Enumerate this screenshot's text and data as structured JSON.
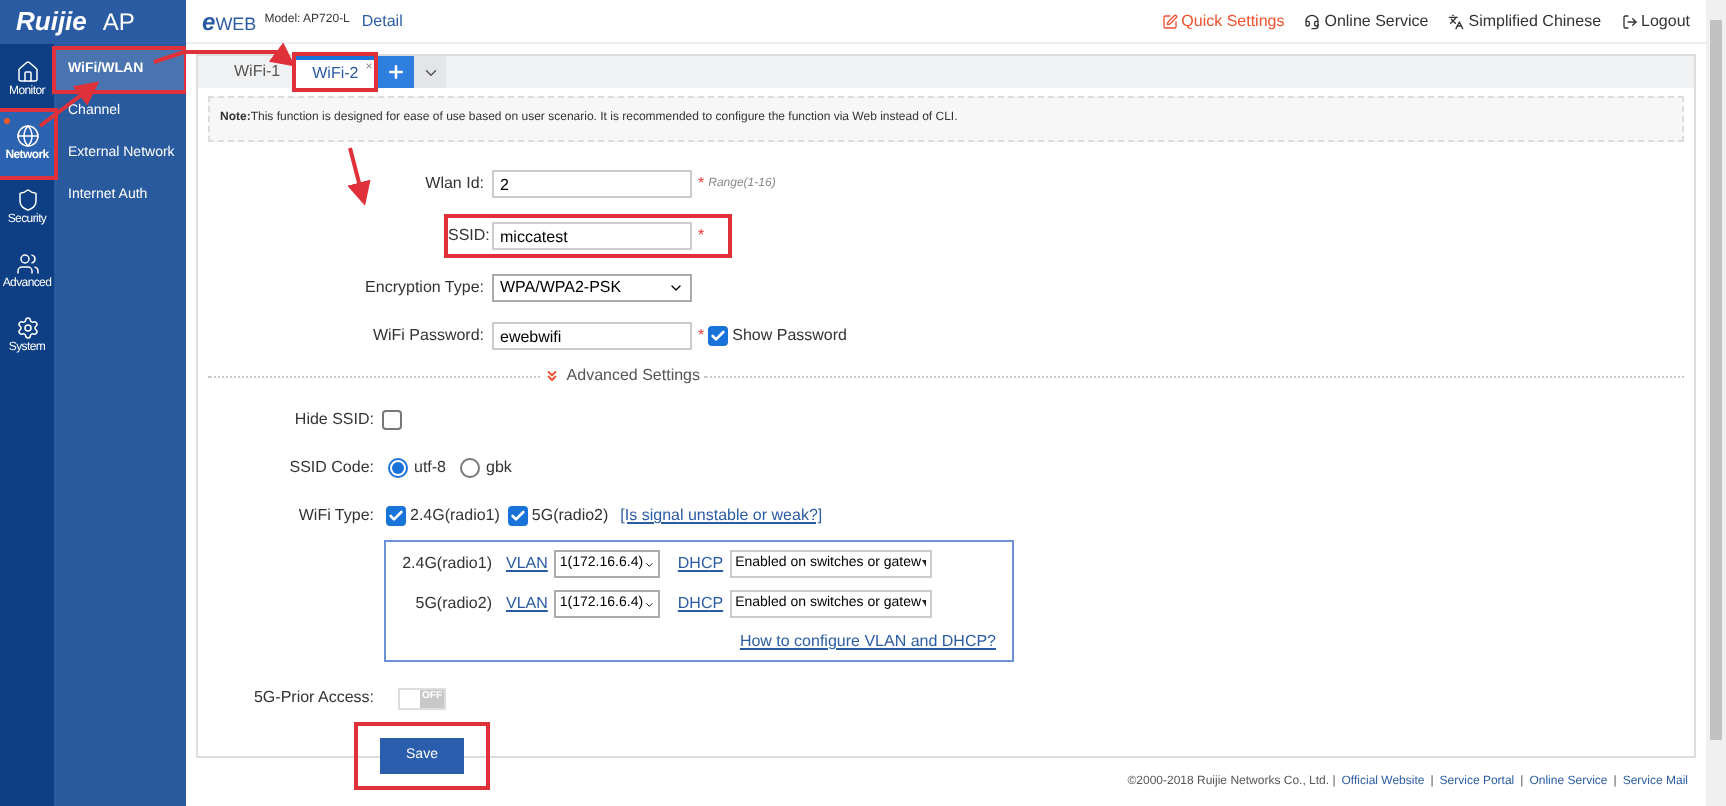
{
  "brand": {
    "logo": "Ruijie",
    "product": "AP"
  },
  "header": {
    "eweb_mark": "e",
    "eweb": "WEB",
    "model": "Model: AP720-L",
    "detail_link": "Detail",
    "actions": [
      {
        "kind": "quick",
        "label": "Quick Settings"
      },
      {
        "kind": "service",
        "label": "Online Service"
      },
      {
        "kind": "language",
        "label": "Simplified Chinese"
      },
      {
        "kind": "logout",
        "label": "Logout"
      }
    ]
  },
  "nav_rail": [
    {
      "kind": "monitor",
      "label": "Monitor",
      "selected": false,
      "annotated": false
    },
    {
      "kind": "network",
      "label": "Network",
      "selected": true,
      "annotated": true
    },
    {
      "kind": "security",
      "label": "Security",
      "selected": false,
      "annotated": false
    },
    {
      "kind": "advanced",
      "label": "Advanced",
      "selected": false,
      "annotated": false
    },
    {
      "kind": "system",
      "label": "System",
      "selected": false,
      "annotated": false
    }
  ],
  "submenu": [
    {
      "label": "WiFi/WLAN",
      "selected": true,
      "annotated": true
    },
    {
      "label": "Channel",
      "selected": false,
      "annotated": false
    },
    {
      "label": "External Network",
      "selected": false,
      "annotated": false
    },
    {
      "label": "Internet Auth",
      "selected": false,
      "annotated": false
    }
  ],
  "tabs": [
    {
      "label": "WiFi-1",
      "selected": false,
      "annotated": false
    },
    {
      "label": "WiFi-2",
      "selected": true,
      "annotated": true,
      "close": "×"
    }
  ],
  "note": "**Note:**This function is designed for ease of use based on user scenario. It is recommended to configure the function via Web instead of CLI.",
  "form": {
    "wlan_id": {
      "label": "Wlan Id:",
      "value": "2",
      "required": "*",
      "hint": "Range(1-16)"
    },
    "ssid": {
      "label": "SSID:",
      "value": "miccatest",
      "required": "*",
      "annotated": true
    },
    "encryption": {
      "label": "Encryption Type:",
      "value": "WPA/WPA2-PSK"
    },
    "password": {
      "label": "WiFi Password:",
      "value": "ewebwifi",
      "required": "*",
      "show_password": {
        "label": "Show Password",
        "checked": true
      }
    }
  },
  "advanced": {
    "title": "Advanced Settings",
    "hide_ssid": {
      "label": "Hide SSID:",
      "checked": false
    },
    "ssid_code": {
      "label": "SSID Code:",
      "options": [
        {
          "label": "utf-8",
          "selected": true
        },
        {
          "label": "gbk",
          "selected": false
        }
      ]
    },
    "wifi_type": {
      "label": "WiFi Type:",
      "options": [
        {
          "label": "2.4G(radio1)",
          "checked": true
        },
        {
          "label": "5G(radio2)",
          "checked": true
        }
      ],
      "link": "[Is signal unstable or weak?]"
    },
    "radios": [
      {
        "name": "2.4G(radio1)",
        "vlan_label": "VLAN",
        "vlan": "1(172.16.6.4)",
        "dhcp_label": "DHCP",
        "dhcp": "Enabled on switches or gatew"
      },
      {
        "name": "5G(radio2)",
        "vlan_label": "VLAN",
        "vlan": "1(172.16.6.4)",
        "dhcp_label": "DHCP",
        "dhcp": "Enabled on switches or gatew"
      }
    ],
    "help_link": "How to configure VLAN and DHCP?",
    "prior_access": {
      "label": "5G-Prior Access:",
      "on": false,
      "state_label": "OFF"
    }
  },
  "save": {
    "label": "Save",
    "annotated": true
  },
  "footer": {
    "copyright": "©2000-2018 Ruijie Networks Co., Ltd. |",
    "links": [
      {
        "label": "Official Website"
      },
      {
        "separator": "|",
        "label": "Service Portal"
      },
      {
        "separator": "|",
        "label": "Online Service"
      },
      {
        "separator": "|",
        "label": "Service Mail"
      }
    ]
  }
}
